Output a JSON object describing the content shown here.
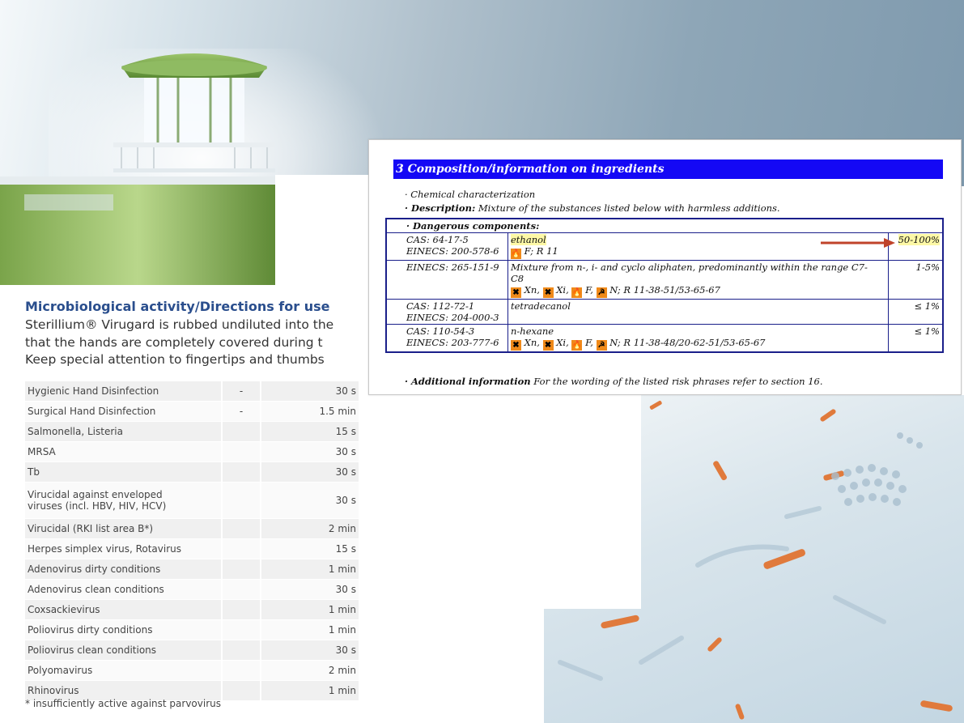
{
  "activity": {
    "title": "Microbiological activity/Directions for use",
    "description_lines": [
      "Sterillium® Virugard is rubbed undiluted into the",
      "that the hands are completely covered during t",
      "Keep special attention to fingertips and thumbs"
    ],
    "rows": [
      {
        "name": "Hygienic Hand Disinfection",
        "mark": "-",
        "time": "30 s"
      },
      {
        "name": "Surgical Hand Disinfection",
        "mark": "-",
        "time": "1.5 min"
      },
      {
        "name": "Salmonella, Listeria",
        "mark": "",
        "time": "15 s"
      },
      {
        "name": "MRSA",
        "mark": "",
        "time": "30 s"
      },
      {
        "name": "Tb",
        "mark": "",
        "time": "30 s"
      },
      {
        "name": "Virucidal against enveloped",
        "name2": "viruses (incl. HBV, HIV, HCV)",
        "mark": "",
        "time": "30 s"
      },
      {
        "name": "Virucidal (RKI list area B*)",
        "mark": "",
        "time": "2 min"
      },
      {
        "name": "Herpes simplex virus, Rotavirus",
        "mark": "",
        "time": "15 s"
      },
      {
        "name": "Adenovirus dirty conditions",
        "mark": "",
        "time": "1 min"
      },
      {
        "name": "Adenovirus clean conditions",
        "mark": "",
        "time": "30 s"
      },
      {
        "name": "Coxsackievirus",
        "mark": "",
        "time": "1 min"
      },
      {
        "name": "Poliovirus dirty conditions",
        "mark": "",
        "time": "1 min"
      },
      {
        "name": "Poliovirus clean conditions",
        "mark": "",
        "time": "30 s"
      },
      {
        "name": "Polyomavirus",
        "mark": "",
        "time": "2 min"
      },
      {
        "name": "Rhinovirus",
        "mark": "",
        "time": "1 min"
      }
    ],
    "footnote": "* insufficiently active against parvovirus"
  },
  "composition": {
    "header": "3 Composition/information on ingredients",
    "chem_label": "· Chemical characterization",
    "desc_label": "· Description:",
    "desc_text": " Mixture of the substances listed below with harmless additions.",
    "dangerous_label": "· Dangerous components:",
    "rows": [
      {
        "id1": "CAS: 64-17-5",
        "id2": "EINECS: 200-578-6",
        "name": "ethanol",
        "risk": " F; R 11",
        "pct": "50-100%"
      },
      {
        "id1": "EINECS: 265-151-9",
        "id2": "",
        "name": "Mixture from n-, i- and cyclo aliphaten, predominantly within the range C7-",
        "name2": "C8",
        "risk": "R 11-38-51/53-65-67",
        "pct": "1-5%"
      },
      {
        "id1": "CAS: 112-72-1",
        "id2": "EINECS: 204-000-3",
        "name": "tetradecanol",
        "pct": "≤ 1%"
      },
      {
        "id1": "CAS: 110-54-3",
        "id2": "EINECS: 203-777-6",
        "name": "n-hexane",
        "risk": "R 11-38-48/20-62-51/53-65-67",
        "pct": "≤ 1%"
      }
    ],
    "hazard_labels": {
      "xn": "Xn,",
      "xi": "Xi,",
      "f": "F,",
      "n": "N;"
    },
    "additional_label": "· Additional information",
    "additional_text": " For the wording of the listed risk phrases refer to section 16."
  },
  "colors": {
    "header_bg": "#1408f5",
    "title_blue": "#2a4e8d",
    "highlight": "#fdf8a6",
    "arrow": "#c0432a"
  }
}
